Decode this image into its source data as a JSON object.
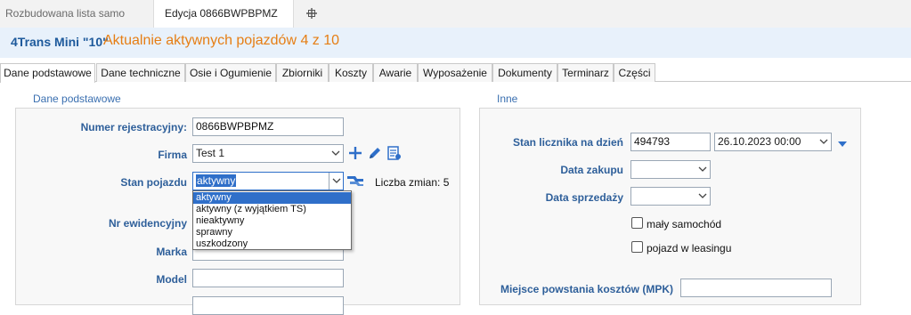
{
  "doc_tabs": [
    {
      "label": "Rozbudowana lista samo"
    },
    {
      "label": "Edycja 0866BWPBPMZ"
    }
  ],
  "header": {
    "model": "4Trans Mini \"10\"",
    "active_info": "Aktualnie aktywnych pojazdów 4 z 10"
  },
  "section_tabs": [
    {
      "label": "Dane podstawowe"
    },
    {
      "label": "Dane techniczne"
    },
    {
      "label": "Osie i Ogumienie"
    },
    {
      "label": "Zbiorniki"
    },
    {
      "label": "Koszty"
    },
    {
      "label": "Awarie"
    },
    {
      "label": "Wyposażenie"
    },
    {
      "label": "Dokumenty"
    },
    {
      "label": "Terminarz"
    },
    {
      "label": "Części"
    }
  ],
  "left": {
    "title": "Dane podstawowe",
    "nr_rej_label": "Numer rejestracyjny:",
    "nr_rej_value": "0866BWPBPMZ",
    "firma_label": "Firma",
    "firma_value": "Test 1",
    "stan_label": "Stan pojazdu",
    "stan_value": "aktywny",
    "liczba_zmian": "Liczba zmian: 5",
    "stan_options": [
      "aktywny",
      "aktywny (z wyjątkiem TS)",
      "nieaktywny",
      "sprawny",
      "uszkodzony"
    ],
    "nr_ewid_label": "Nr ewidencyjny",
    "marka_label": "Marka",
    "model_label": "Model"
  },
  "right": {
    "title": "Inne",
    "licznik_label": "Stan licznika na dzień",
    "licznik_value": "494793",
    "licznik_date": "26.10.2023 00:00",
    "data_zakupu_label": "Data zakupu",
    "data_sprzedazy_label": "Data sprzedaży",
    "maly_label": "mały samochód",
    "leasing_label": "pojazd w leasingu",
    "mpk_label": "Miejsce powstania kosztów (MPK)"
  }
}
